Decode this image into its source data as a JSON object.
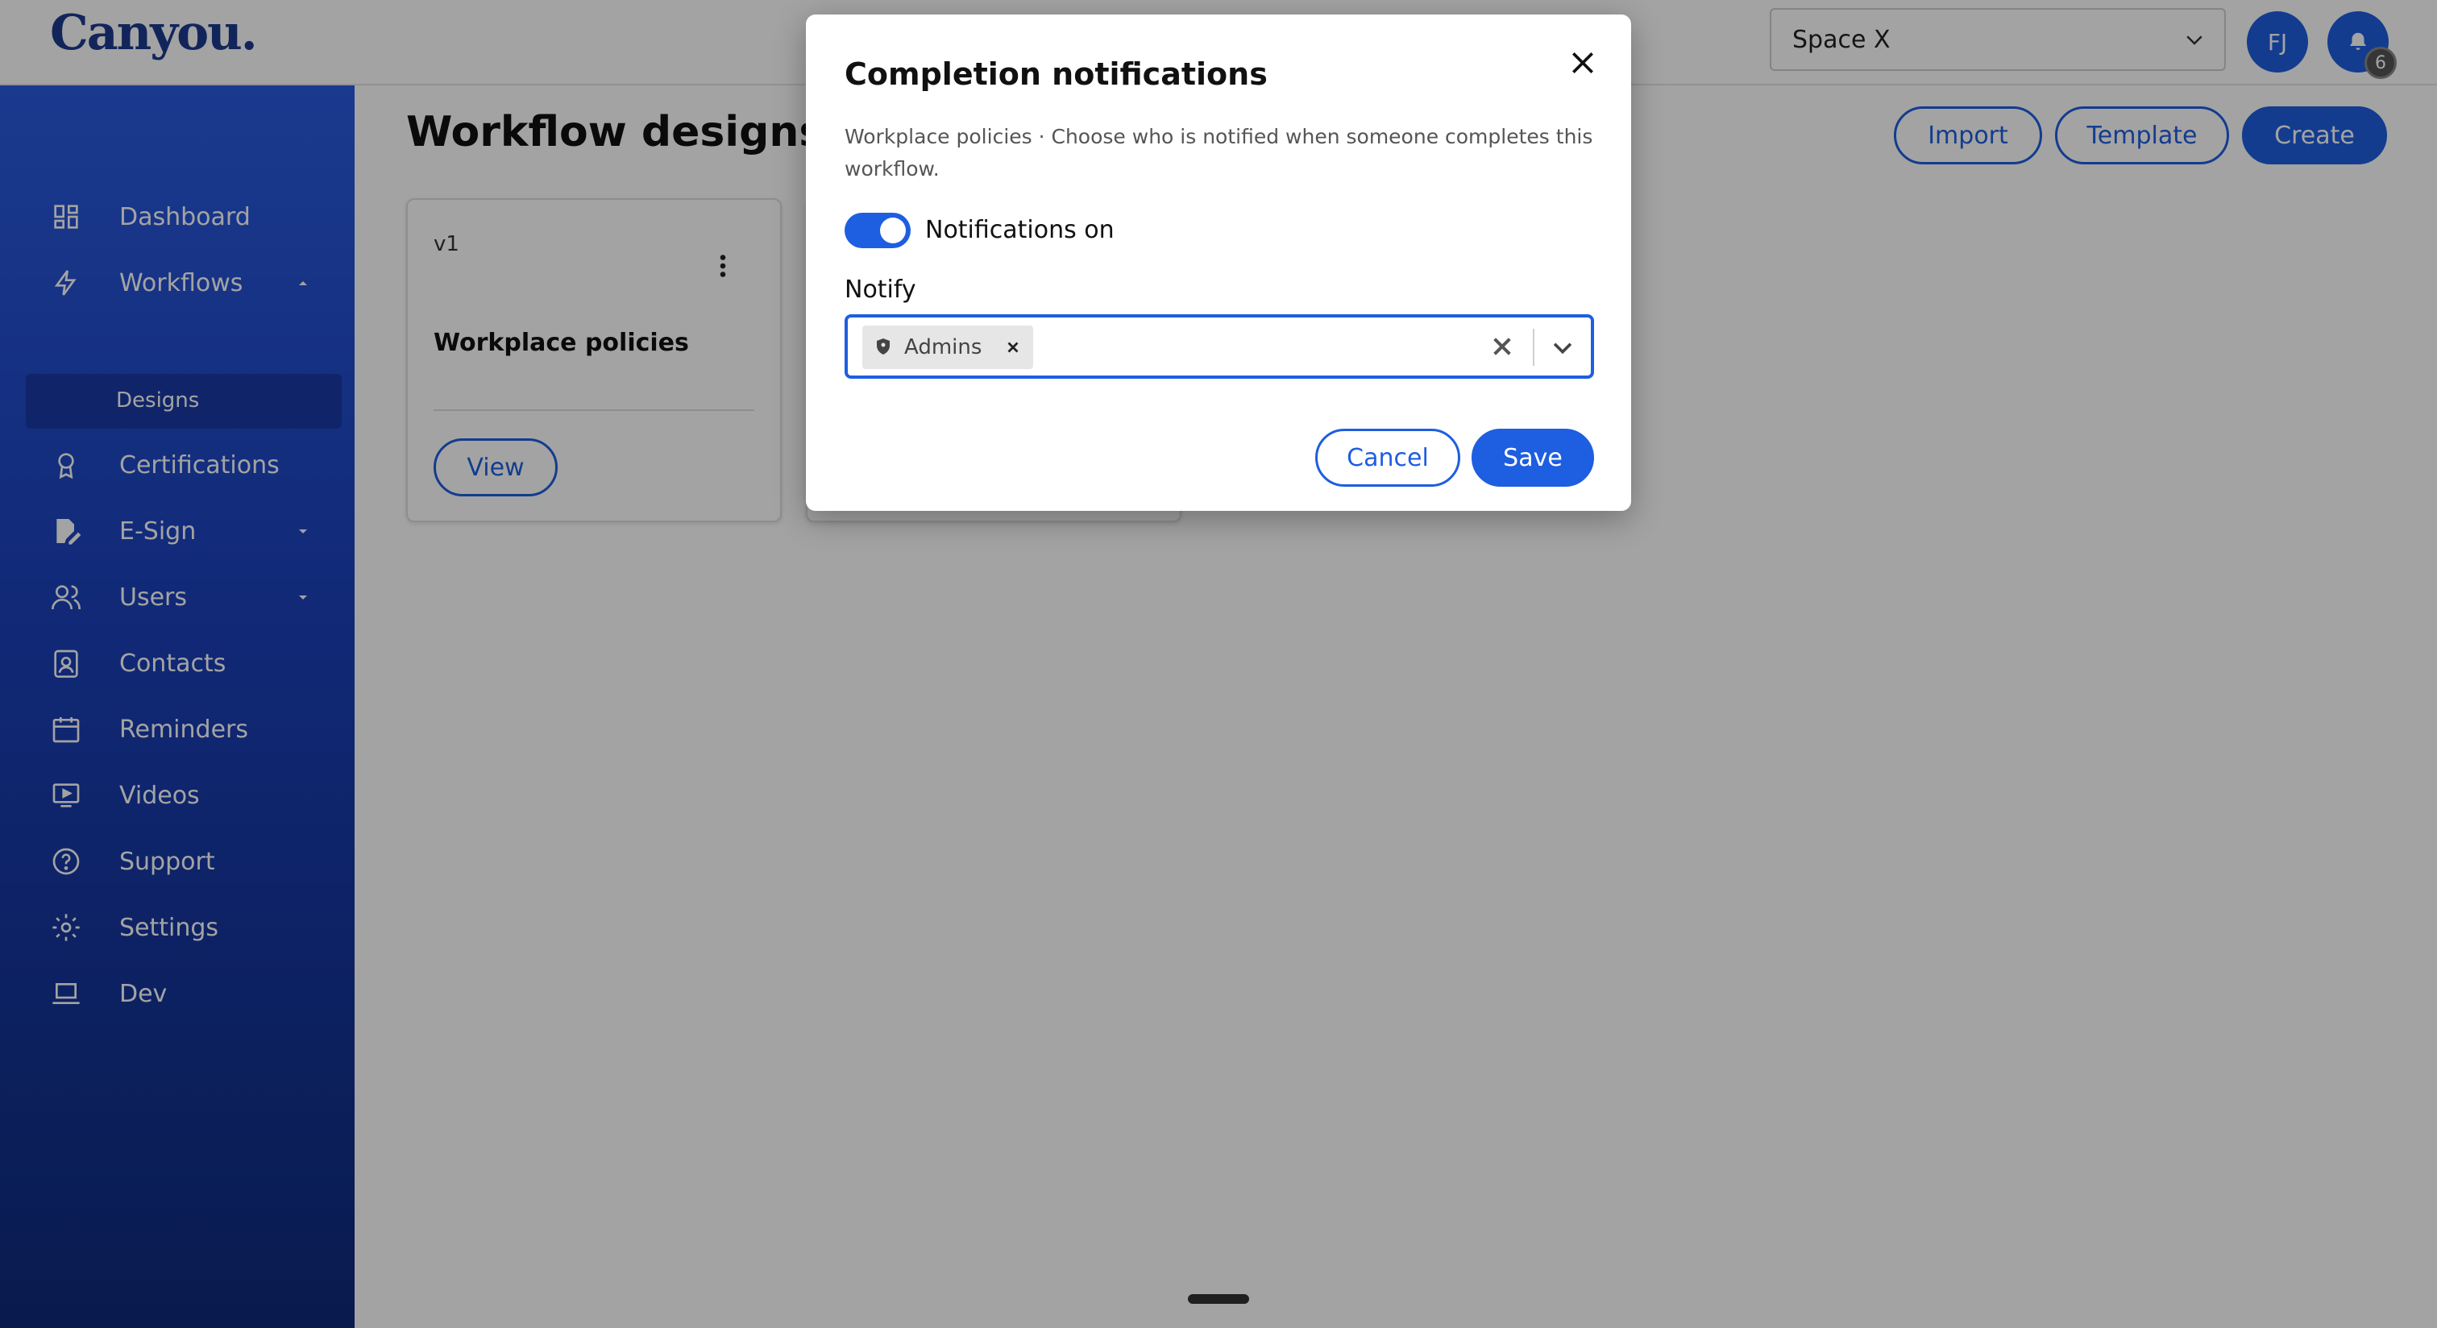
{
  "header": {
    "logo": "Canyou.",
    "space_select": "Space X",
    "avatar_initials": "FJ",
    "notification_count": "6"
  },
  "sidebar": {
    "items": [
      {
        "label": "Dashboard",
        "icon": "dashboard-icon"
      },
      {
        "label": "Workflows",
        "icon": "lightning-icon"
      },
      {
        "label": "Designs"
      },
      {
        "label": "Certifications",
        "icon": "award-icon"
      },
      {
        "label": "E-Sign",
        "icon": "pen-document-icon"
      },
      {
        "label": "Users",
        "icon": "users-icon"
      },
      {
        "label": "Contacts",
        "icon": "contact-card-icon"
      },
      {
        "label": "Reminders",
        "icon": "calendar-icon"
      },
      {
        "label": "Videos",
        "icon": "video-icon"
      },
      {
        "label": "Support",
        "icon": "help-icon"
      },
      {
        "label": "Settings",
        "icon": "gear-icon"
      },
      {
        "label": "Dev",
        "icon": "laptop-icon"
      }
    ]
  },
  "main": {
    "title": "Workflow designs",
    "import_label": "Import",
    "template_label": "Template",
    "create_label": "Create",
    "card": {
      "version": "v1",
      "name": "Workplace policies",
      "view_label": "View"
    }
  },
  "modal": {
    "title": "Completion notifications",
    "description": "Workplace policies · Choose who is notified when someone completes this workflow.",
    "toggle_label": "Notifications on",
    "toggle_on": true,
    "notify_label": "Notify",
    "selected": [
      "Admins"
    ],
    "cancel_label": "Cancel",
    "save_label": "Save"
  },
  "colors": {
    "accent": "#1e5ee0",
    "logo": "#1d3a8f",
    "sidebar_top": "#2a5be0",
    "sidebar_bottom": "#0f2a7a"
  }
}
